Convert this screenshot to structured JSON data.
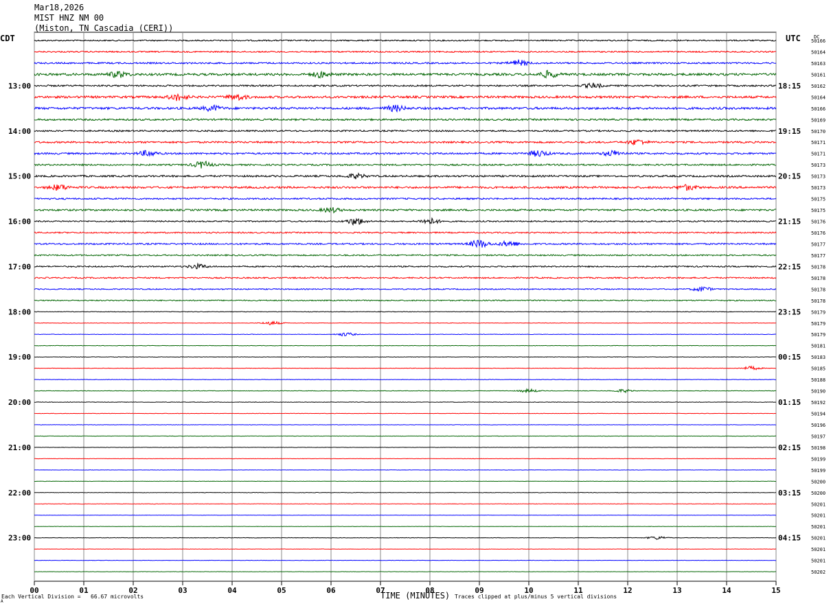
{
  "header": {
    "date": "Mar18,2026",
    "station": "MIST HNZ NM 00",
    "location": "(Miston, TN Cascadia (CERI))"
  },
  "axes": {
    "left_tz": "CDT",
    "right_tz": "UTC",
    "dc_label": "DC",
    "x_title": "TIME (MINUTES)",
    "footer_left": "Each Vertical Division =   66.67 microvolts",
    "footer_right": "Traces clipped at plus/minus 5 vertical divisions",
    "corner_mark": "A"
  },
  "colors": {
    "cycle": [
      "#000000",
      "#ff0000",
      "#0000ff",
      "#006400"
    ],
    "grid": "#888888"
  },
  "chart_data": {
    "type": "line",
    "title": "MIST HNZ NM 00",
    "xlabel": "TIME (MINUTES)",
    "xlim": [
      0,
      15
    ],
    "x_ticks": [
      "00",
      "01",
      "02",
      "03",
      "04",
      "05",
      "06",
      "07",
      "08",
      "09",
      "10",
      "11",
      "12",
      "13",
      "14",
      "15"
    ],
    "left_hour_labels": [
      {
        "row": 4,
        "label": "13:00"
      },
      {
        "row": 8,
        "label": "14:00"
      },
      {
        "row": 12,
        "label": "15:00"
      },
      {
        "row": 16,
        "label": "16:00"
      },
      {
        "row": 20,
        "label": "17:00"
      },
      {
        "row": 24,
        "label": "18:00"
      },
      {
        "row": 28,
        "label": "19:00"
      },
      {
        "row": 32,
        "label": "20:00"
      },
      {
        "row": 36,
        "label": "21:00"
      },
      {
        "row": 40,
        "label": "22:00"
      },
      {
        "row": 44,
        "label": "23:00"
      }
    ],
    "right_hour_labels": [
      {
        "row": 4,
        "label": "18:15"
      },
      {
        "row": 8,
        "label": "19:15"
      },
      {
        "row": 12,
        "label": "20:15"
      },
      {
        "row": 16,
        "label": "21:15"
      },
      {
        "row": 20,
        "label": "22:15"
      },
      {
        "row": 24,
        "label": "23:15"
      },
      {
        "row": 28,
        "label": "00:15"
      },
      {
        "row": 32,
        "label": "01:15"
      },
      {
        "row": 36,
        "label": "02:15"
      },
      {
        "row": 40,
        "label": "03:15"
      },
      {
        "row": 44,
        "label": "04:15"
      }
    ],
    "dc_offsets": [
      "50166",
      "50164",
      "50163",
      "50161",
      "50162",
      "50164",
      "50166",
      "50169",
      "50170",
      "50171",
      "50171",
      "50173",
      "50173",
      "50173",
      "50175",
      "50175",
      "50176",
      "50176",
      "50177",
      "50177",
      "50178",
      "50178",
      "50178",
      "50178",
      "50179",
      "50179",
      "50179",
      "50181",
      "50183",
      "50185",
      "50188",
      "50190",
      "50192",
      "50194",
      "50196",
      "50197",
      "50198",
      "50199",
      "50199",
      "50200",
      "50200",
      "50201",
      "50201",
      "50201",
      "50201",
      "50201",
      "50201",
      "50202"
    ],
    "trace_amplitude": [
      0.6,
      0.6,
      0.7,
      1.0,
      0.7,
      1.0,
      1.0,
      0.8,
      0.7,
      0.8,
      0.8,
      0.7,
      0.8,
      0.9,
      0.7,
      0.8,
      0.6,
      0.6,
      0.7,
      0.6,
      0.6,
      0.6,
      0.5,
      0.5,
      0.25,
      0.2,
      0.2,
      0.2,
      0.2,
      0.2,
      0.2,
      0.2,
      0.2,
      0.15,
      0.15,
      0.15,
      0.15,
      0.15,
      0.15,
      0.15,
      0.2,
      0.2,
      0.15,
      0.15,
      0.2,
      0.15,
      0.15,
      0.15
    ],
    "events": [
      {
        "row": 3,
        "minute": 1.7,
        "size": 2.6
      },
      {
        "row": 3,
        "minute": 5.8,
        "size": 2.4
      },
      {
        "row": 2,
        "minute": 9.8,
        "size": 2.6
      },
      {
        "row": 3,
        "minute": 10.4,
        "size": 2.8
      },
      {
        "row": 4,
        "minute": 11.3,
        "size": 2.0
      },
      {
        "row": 5,
        "minute": 2.9,
        "size": 2.8
      },
      {
        "row": 5,
        "minute": 4.1,
        "size": 2.4
      },
      {
        "row": 6,
        "minute": 3.6,
        "size": 2.2
      },
      {
        "row": 6,
        "minute": 7.3,
        "size": 2.4
      },
      {
        "row": 9,
        "minute": 12.2,
        "size": 2.2
      },
      {
        "row": 10,
        "minute": 2.3,
        "size": 2.4
      },
      {
        "row": 10,
        "minute": 10.2,
        "size": 2.6
      },
      {
        "row": 10,
        "minute": 11.7,
        "size": 2.4
      },
      {
        "row": 11,
        "minute": 3.4,
        "size": 3.0
      },
      {
        "row": 12,
        "minute": 6.5,
        "size": 2.0
      },
      {
        "row": 13,
        "minute": 0.5,
        "size": 2.4
      },
      {
        "row": 13,
        "minute": 13.2,
        "size": 2.2
      },
      {
        "row": 15,
        "minute": 6.0,
        "size": 2.0
      },
      {
        "row": 16,
        "minute": 6.5,
        "size": 3.0
      },
      {
        "row": 16,
        "minute": 8.0,
        "size": 2.6
      },
      {
        "row": 18,
        "minute": 9.0,
        "size": 3.4
      },
      {
        "row": 18,
        "minute": 9.6,
        "size": 2.4
      },
      {
        "row": 20,
        "minute": 3.3,
        "size": 2.0
      },
      {
        "row": 22,
        "minute": 13.5,
        "size": 2.0
      },
      {
        "row": 25,
        "minute": 4.8,
        "size": 1.6
      },
      {
        "row": 26,
        "minute": 6.3,
        "size": 1.6
      },
      {
        "row": 29,
        "minute": 14.5,
        "size": 1.6
      },
      {
        "row": 31,
        "minute": 10.0,
        "size": 1.6
      },
      {
        "row": 31,
        "minute": 11.9,
        "size": 1.4
      },
      {
        "row": 44,
        "minute": 12.6,
        "size": 1.4
      }
    ]
  }
}
